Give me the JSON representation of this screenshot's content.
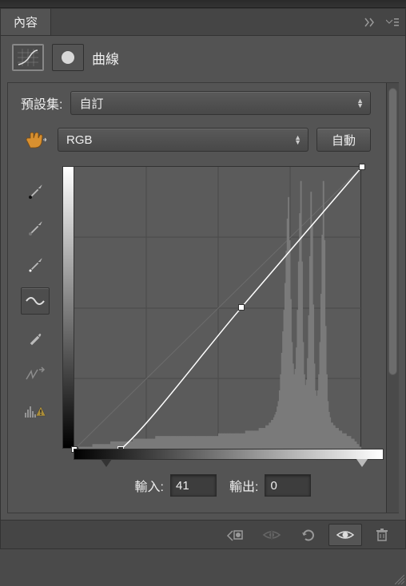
{
  "panel": {
    "title_tab": "內容",
    "adjustment_label": "曲線"
  },
  "preset": {
    "label": "預設集:",
    "value": "自訂"
  },
  "channel": {
    "value": "RGB",
    "auto_label": "自動"
  },
  "io": {
    "input_label": "輸入:",
    "input_value": "41",
    "output_label": "輸出:",
    "output_value": "0"
  },
  "chart_data": {
    "type": "line",
    "title": "",
    "xlabel": "輸入",
    "ylabel": "輸出",
    "xlim": [
      0,
      255
    ],
    "ylim": [
      0,
      255
    ],
    "curve_points": [
      {
        "x": 0,
        "y": 0
      },
      {
        "x": 41,
        "y": 0
      },
      {
        "x": 148,
        "y": 128
      },
      {
        "x": 255,
        "y": 255
      }
    ],
    "histogram": [
      0,
      0,
      0,
      0,
      1,
      1,
      1,
      1,
      1,
      1,
      1,
      1,
      1,
      1,
      1,
      1,
      2,
      2,
      2,
      2,
      2,
      2,
      2,
      2,
      2,
      2,
      2,
      2,
      2,
      2,
      2,
      2,
      3,
      3,
      3,
      3,
      3,
      3,
      3,
      3,
      3,
      3,
      3,
      3,
      3,
      3,
      3,
      3,
      3,
      3,
      3,
      3,
      4,
      4,
      4,
      4,
      4,
      4,
      4,
      4,
      4,
      4,
      4,
      4,
      4,
      4,
      4,
      4,
      4,
      4,
      4,
      4,
      5,
      5,
      5,
      5,
      5,
      5,
      5,
      5,
      5,
      5,
      5,
      5,
      5,
      5,
      5,
      5,
      5,
      5,
      5,
      5,
      5,
      5,
      5,
      5,
      5,
      5,
      5,
      5,
      5,
      5,
      5,
      5,
      5,
      5,
      5,
      5,
      5,
      5,
      5,
      5,
      5,
      5,
      5,
      5,
      5,
      5,
      5,
      5,
      5,
      5,
      5,
      5,
      5,
      5,
      5,
      5,
      6,
      6,
      6,
      6,
      6,
      6,
      6,
      6,
      6,
      6,
      6,
      6,
      6,
      6,
      6,
      6,
      6,
      6,
      6,
      6,
      6,
      6,
      6,
      6,
      7,
      7,
      7,
      7,
      7,
      7,
      7,
      7,
      7,
      7,
      7,
      7,
      8,
      8,
      8,
      8,
      8,
      8,
      9,
      9,
      9,
      10,
      10,
      11,
      11,
      12,
      13,
      14,
      16,
      18,
      22,
      28,
      36,
      44,
      52,
      62,
      74,
      86,
      94,
      78,
      56,
      40,
      32,
      28,
      30,
      38,
      52,
      70,
      88,
      100,
      70,
      40,
      28,
      24,
      26,
      34,
      50,
      72,
      96,
      84,
      54,
      32,
      22,
      20,
      22,
      28,
      40,
      58,
      80,
      100,
      78,
      46,
      28,
      18,
      14,
      12,
      10,
      10,
      9,
      9,
      8,
      8,
      8,
      7,
      7,
      7,
      6,
      6,
      6,
      6,
      5,
      5,
      5,
      5,
      4,
      4,
      4,
      3,
      3,
      2,
      2,
      1,
      1,
      0
    ]
  },
  "sliders": {
    "black_pos_pct": 11,
    "white_pos_pct": 100
  },
  "icons": {
    "curves_icon": "curves",
    "mask_icon": "mask"
  }
}
